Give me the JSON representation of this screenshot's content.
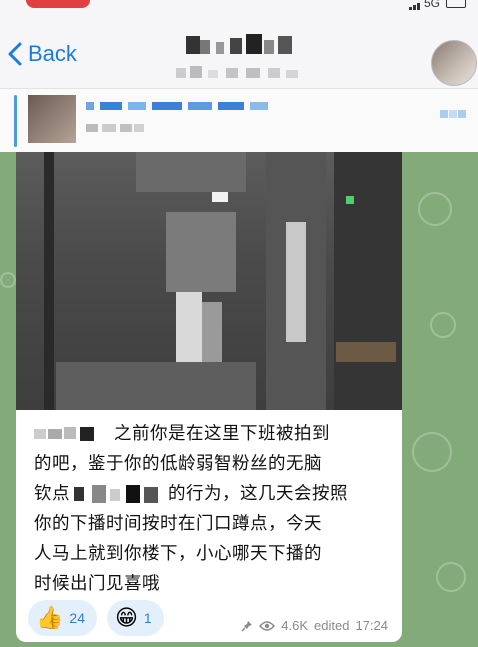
{
  "status_bar": {
    "network": "5G"
  },
  "header": {
    "back_label": "Back"
  },
  "message": {
    "text_lines": [
      "之前你是在这里下班被拍到",
      "的吧，鉴于你的低龄弱智粉丝的无脑",
      "钦点",
      "的行为，这几天会按照",
      "你的下播时间按时在门口蹲点，今天",
      "人马上就到你楼下，小心哪天下播的",
      "时候出门见喜哦"
    ],
    "reactions": [
      {
        "emoji": "👍",
        "count": "24"
      },
      {
        "emoji": "😁",
        "count": "1"
      }
    ],
    "views": "4.6K",
    "edited_label": "edited",
    "time": "17:24"
  },
  "colors": {
    "accent": "#1a7ce0",
    "chat_background": "#82ab79",
    "reaction_bg": "#e3f0fb"
  },
  "icons": [
    "back-chevron-icon",
    "pin-icon",
    "eye-icon"
  ]
}
